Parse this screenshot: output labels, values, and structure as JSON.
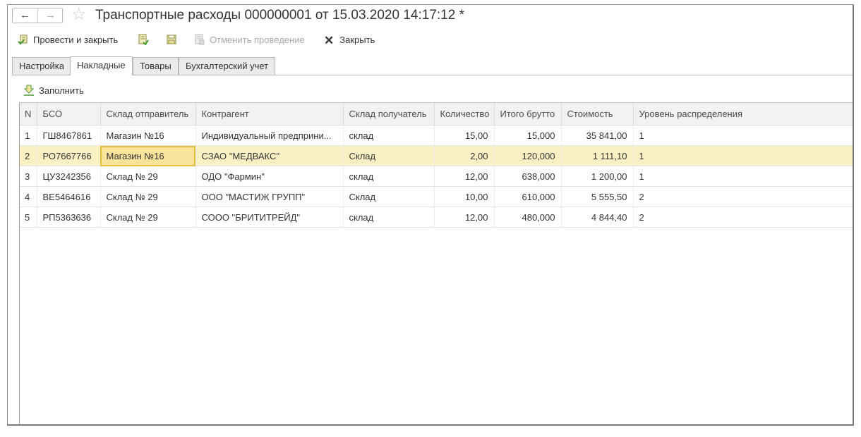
{
  "window": {
    "title": "Транспортные расходы 000000001 от 15.03.2020 14:17:12 *",
    "nav": {
      "back_icon": "←",
      "forward_icon": "→"
    },
    "favorite_icon": "☆"
  },
  "toolbar": {
    "post_close": "Провести и закрыть",
    "undo_post": "Отменить проведение",
    "close": "Закрыть",
    "close_icon": "✕"
  },
  "tabs": [
    {
      "label": "Настройка",
      "active": false
    },
    {
      "label": "Накладные",
      "active": true
    },
    {
      "label": "Товары",
      "active": false
    },
    {
      "label": "Бухгалтерский учет",
      "active": false
    }
  ],
  "fill_button": "Заполнить",
  "table": {
    "columns": [
      "N",
      "БСО",
      "Склад отправитель",
      "Контрагент",
      "Склад получатель",
      "Количество",
      "Итого брутто",
      "Стоимость",
      "Уровень распределения"
    ],
    "rows": [
      [
        "1",
        "ГШ8467861",
        "Магазин №16",
        "Индивидуальный предприни...",
        "склад",
        "15,00",
        "15,000",
        "35 841,00",
        "1"
      ],
      [
        "2",
        "РО7667766",
        "Магазин №16",
        "СЗАО \"МЕДВАКС\"",
        "Склад",
        "2,00",
        "120,000",
        "1 111,10",
        "1"
      ],
      [
        "3",
        "ЦУ3242356",
        "Склад № 29",
        "ОДО \"Фармин\"",
        "склад",
        "12,00",
        "638,000",
        "1 200,00",
        "1"
      ],
      [
        "4",
        "ВЕ5464616",
        "Склад № 29",
        "ООО \"МАСТИЖ ГРУПП\"",
        "Склад",
        "10,00",
        "610,000",
        "5 555,50",
        "2"
      ],
      [
        "5",
        "РП5363636",
        "Склад № 29",
        "СООО \"БРИТИТРЕЙД\"",
        "склад",
        "12,00",
        "480,000",
        "4 844,40",
        "2"
      ]
    ],
    "selected_row": 2,
    "current_cell_column": 3
  },
  "colors": {
    "selected_row": "#fbf0c4",
    "current_cell": "#f9e39a",
    "current_cell_border": "#e6be3e"
  }
}
